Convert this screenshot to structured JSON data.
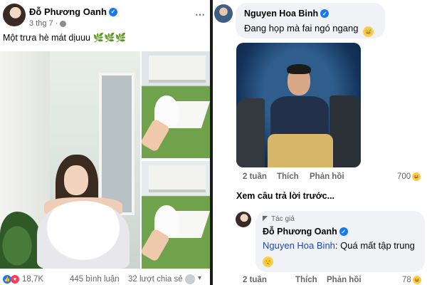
{
  "post": {
    "author": "Đỗ Phương Oanh",
    "date": "3 thg 7",
    "caption": "Một trưa hè mát dịuuu 🌿🌿🌿",
    "reactions_count": "18,7K",
    "comments_count": "445 bình luận",
    "shares_count": "32 lượt chia sẻ",
    "more_icon": "⋯",
    "verified_icon": "✓",
    "like_icon": "👍",
    "love_icon": "♥",
    "caret_icon": "▾"
  },
  "comments": {
    "first": {
      "author": "Nguyen Hoa Binh",
      "text": "Đang họp mà fai ngó ngang",
      "emoji": "😅",
      "time": "2 tuần",
      "like_label": "Thích",
      "reply_label": "Phản hồi",
      "reaction_count": "700",
      "reaction_emoji": "😆"
    },
    "view_previous": "Xem câu trả lời trước...",
    "reply": {
      "author_badge": "Tác giả",
      "author": "Đỗ Phương Oanh",
      "mention": "Nguyen Hoa Binh",
      "text": ": Quá mất tập trung",
      "emoji": "😌",
      "time": "2 tuần",
      "like_label": "Thích",
      "reply_label": "Phản hồi",
      "reaction_count": "78",
      "reaction_emoji": "😆"
    }
  },
  "colors": {
    "facebook_blue": "#1877f2",
    "mention_blue": "#1c4bb4",
    "secondary_text": "#65676b",
    "bubble_bg": "#f0f2f5"
  }
}
